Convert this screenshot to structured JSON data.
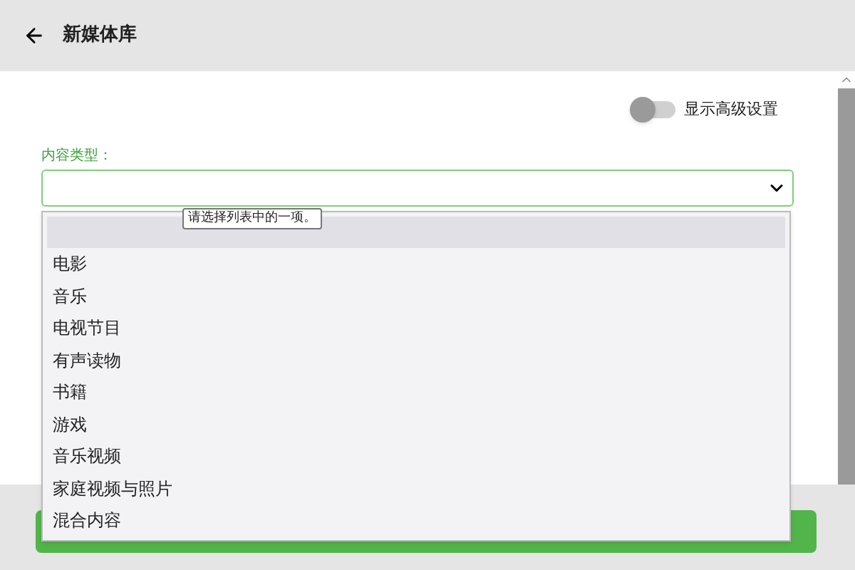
{
  "header": {
    "title": "新媒体库"
  },
  "advanced_toggle": {
    "label": "显示高级设置",
    "on": false
  },
  "content_type": {
    "label": "内容类型：",
    "tooltip": "请选择列表中的一项。",
    "expanded": true,
    "blank_option": {
      "highlighted": true
    },
    "options": [
      {
        "label": "电影",
        "highlighted": false
      },
      {
        "label": "音乐",
        "highlighted": false
      },
      {
        "label": "电视节目",
        "highlighted": false
      },
      {
        "label": "有声读物",
        "highlighted": false
      },
      {
        "label": "书籍",
        "highlighted": false
      },
      {
        "label": "游戏",
        "highlighted": false
      },
      {
        "label": "音乐视频",
        "highlighted": false
      },
      {
        "label": "家庭视频与照片",
        "highlighted": false
      },
      {
        "label": "混合内容",
        "highlighted": false
      }
    ]
  }
}
